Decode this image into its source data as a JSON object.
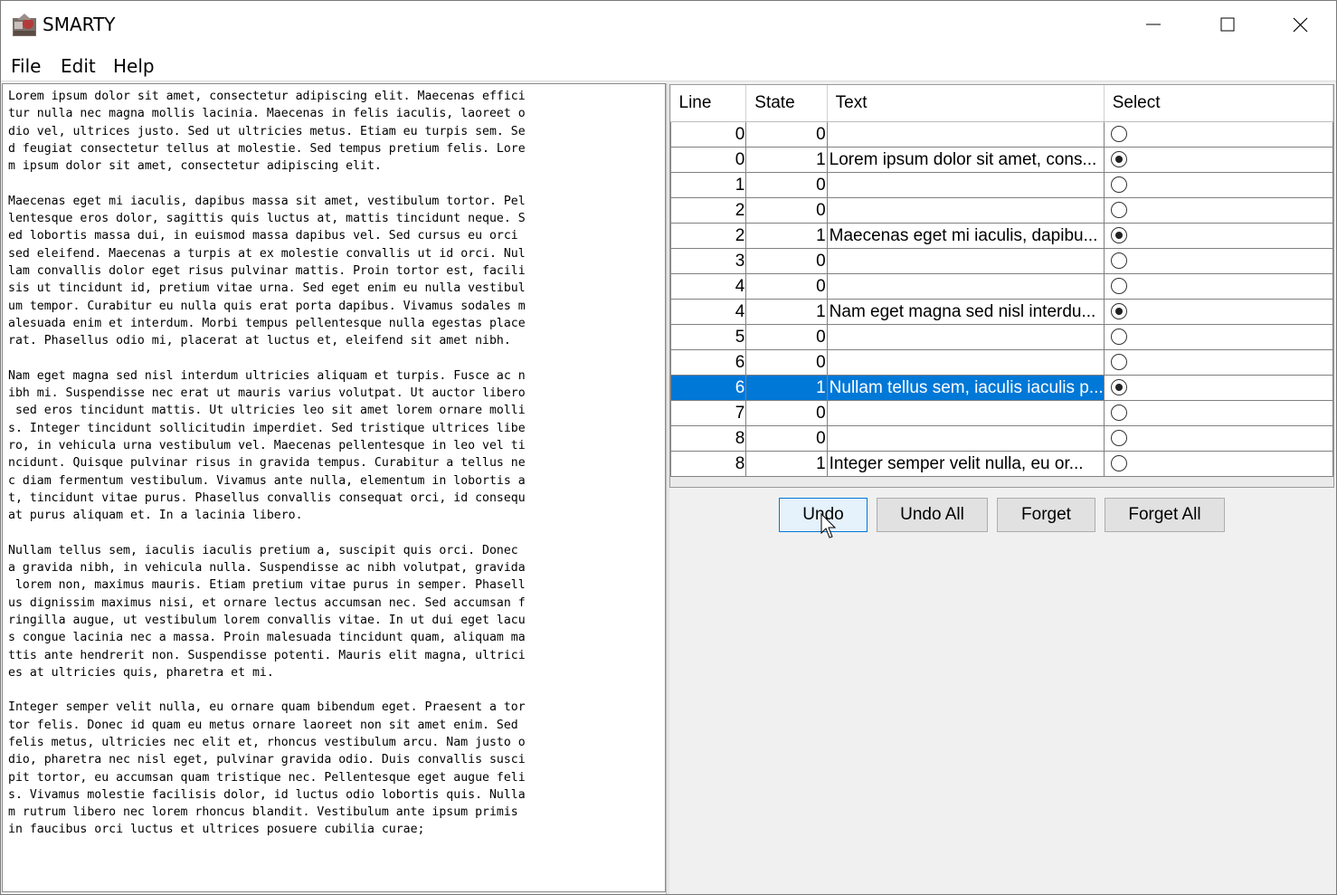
{
  "window": {
    "title": "SMARTY"
  },
  "menu": [
    "File",
    "Edit",
    "Help"
  ],
  "editor": {
    "lines": [
      "Lorem ipsum dolor sit amet, consectetur adipiscing elit. Maecenas effici",
      "tur nulla nec magna mollis lacinia. Maecenas in felis iaculis, laoreet o",
      "dio vel, ultrices justo. Sed ut ultricies metus. Etiam eu turpis sem. Se",
      "d feugiat consectetur tellus at molestie. Sed tempus pretium felis. Lore",
      "m ipsum dolor sit amet, consectetur adipiscing elit.",
      "",
      "Maecenas eget mi iaculis, dapibus massa sit amet, vestibulum tortor. Pel",
      "lentesque eros dolor, sagittis quis luctus at, mattis tincidunt neque. S",
      "ed lobortis massa dui, in euismod massa dapibus vel. Sed cursus eu orci",
      "sed eleifend. Maecenas a turpis at ex molestie convallis ut id orci. Nul",
      "lam convallis dolor eget risus pulvinar mattis. Proin tortor est, facili",
      "sis ut tincidunt id, pretium vitae urna. Sed eget enim eu nulla vestibul",
      "um tempor. Curabitur eu nulla quis erat porta dapibus. Vivamus sodales m",
      "alesuada enim et interdum. Morbi tempus pellentesque nulla egestas place",
      "rat. Phasellus odio mi, placerat at luctus et, eleifend sit amet nibh.",
      "",
      "Nam eget magna sed nisl interdum ultricies aliquam et turpis. Fusce ac n",
      "ibh mi. Suspendisse nec erat ut mauris varius volutpat. Ut auctor libero",
      " sed eros tincidunt mattis. Ut ultricies leo sit amet lorem ornare molli",
      "s. Integer tincidunt sollicitudin imperdiet. Sed tristique ultrices libe",
      "ro, in vehicula urna vestibulum vel. Maecenas pellentesque in leo vel ti",
      "ncidunt. Quisque pulvinar risus in gravida tempus. Curabitur a tellus ne",
      "c diam fermentum vestibulum. Vivamus ante nulla, elementum in lobortis a",
      "t, tincidunt vitae purus. Phasellus convallis consequat orci, id consequ",
      "at purus aliquam et. In a lacinia libero.",
      "",
      "Nullam tellus sem, iaculis iaculis pretium a, suscipit quis orci. Donec",
      "a gravida nibh, in vehicula nulla. Suspendisse ac nibh volutpat, gravida",
      " lorem non, maximus mauris. Etiam pretium vitae purus in semper. Phasell",
      "us dignissim maximus nisi, et ornare lectus accumsan nec. Sed accumsan f",
      "ringilla augue, ut vestibulum lorem convallis vitae. In ut dui eget lacu",
      "s congue lacinia nec a massa. Proin malesuada tincidunt quam, aliquam ma",
      "ttis ante hendrerit non. Suspendisse potenti. Mauris elit magna, ultrici",
      "es at ultricies quis, pharetra et mi.",
      "",
      "Integer semper velit nulla, eu ornare quam bibendum eget. Praesent a tor",
      "tor felis. Donec id quam eu metus ornare laoreet non sit amet enim. Sed",
      "felis metus, ultricies nec elit et, rhoncus vestibulum arcu. Nam justo o",
      "dio, pharetra nec nisl eget, pulvinar gravida odio. Duis convallis susci",
      "pit tortor, eu accumsan quam tristique nec. Pellentesque eget augue feli",
      "s. Vivamus molestie facilisis dolor, id luctus odio lobortis quis. Nulla",
      "m rutrum libero nec lorem rhoncus blandit. Vestibulum ante ipsum primis",
      "in faucibus orci luctus et ultrices posuere cubilia curae;"
    ]
  },
  "table": {
    "columns": [
      "Line",
      "State",
      "Text",
      "Select"
    ],
    "rows": [
      {
        "line": "0",
        "state": "0",
        "text": "",
        "selected": false
      },
      {
        "line": "0",
        "state": "1",
        "text": "Lorem ipsum dolor sit amet, cons...",
        "selected": true
      },
      {
        "line": "1",
        "state": "0",
        "text": "",
        "selected": false
      },
      {
        "line": "2",
        "state": "0",
        "text": "",
        "selected": false
      },
      {
        "line": "2",
        "state": "1",
        "text": "Maecenas eget mi iaculis, dapibu...",
        "selected": true
      },
      {
        "line": "3",
        "state": "0",
        "text": "",
        "selected": false
      },
      {
        "line": "4",
        "state": "0",
        "text": "",
        "selected": false
      },
      {
        "line": "4",
        "state": "1",
        "text": "Nam eget magna sed nisl interdu...",
        "selected": true
      },
      {
        "line": "5",
        "state": "0",
        "text": "",
        "selected": false
      },
      {
        "line": "6",
        "state": "0",
        "text": "",
        "selected": false
      },
      {
        "line": "6",
        "state": "1",
        "text": "Nullam tellus sem, iaculis iaculis p...",
        "selected": true,
        "highlighted": true
      },
      {
        "line": "7",
        "state": "0",
        "text": "",
        "selected": false
      },
      {
        "line": "8",
        "state": "0",
        "text": "",
        "selected": false
      },
      {
        "line": "8",
        "state": "1",
        "text": "Integer semper velit nulla, eu or...",
        "selected": false
      }
    ]
  },
  "buttons": {
    "undo": "Undo",
    "undo_all": "Undo All",
    "forget": "Forget",
    "forget_all": "Forget All"
  },
  "colors": {
    "selection": "#0078d7"
  }
}
